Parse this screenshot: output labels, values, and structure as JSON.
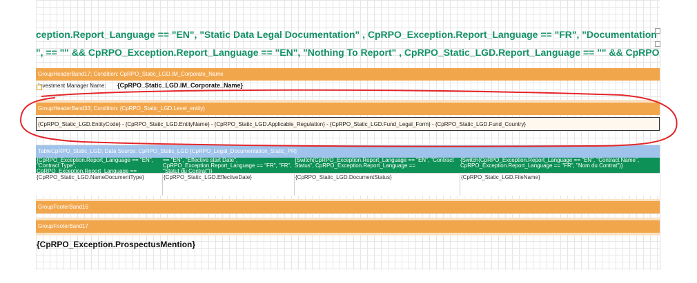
{
  "title_lines": [
    "ception.Report_Language == \"EN\", \"Static Data Legal Documentation\" , CpRPO_Exception.Report_Language == \"FR\", \"Documentation Contractuelle",
    "\", == \"\" && CpRPO_Exception.Report_Language == \"EN\", \"Nothing To Report\" , CpRPO_Static_LGD.Report_Language == \"\" && CpRPO_Exception.Re"
  ],
  "bands": {
    "group_header_17": "GroupHeaderBand17; Condition: CpRPO_Static_LGD.IM_Corporate_Name",
    "group_header_33": "GroupHeaderBand33; Condition: {CpRPO_Static_LGD.Level_entity}",
    "table_band": "TableCpRPO_Static_LGD; Data Source: CpRPO_Static_LGD [CpRPO_Legal_Documentation_Static_PR]",
    "group_footer_16": "GroupFooterBand16",
    "group_footer_17": "GroupFooterBand17"
  },
  "im_row": {
    "label": "Investment Manager Name:",
    "field": "{CpRPO_Static_LGD.IM_Corporate_Name}"
  },
  "entity_row": {
    "text": "{CpRPO_Static_LGD.EntityCode} - {CpRPO_Static_LGD.EntityName} - {CpRPO_Static_LGD.Applicable_Regulation} - {CpRPO_Static_LGD.Fund_Legal_Form} - {CpRPO_Static_LGD.Fund_Country}"
  },
  "table": {
    "headers": [
      "{CpRPO_Exception.Report_Language == \"EN\", \"Contract Type\", CpRPO_Exception.Report_Language ==",
      "== \"EN\", \"Effective start Date\", CpRPO_Exception.Report_Language == \"FR\", \"FR\", \"Statut du Contrat\")}",
      "{Switch(CpRPO_Exception.Report_Language == \"EN\", \"Contract Status\", CpRPO_Exception.Report_Language ==",
      "{Switch(CpRPO_Exception.Report_Language == \"EN\", \"Contract Name\", CpRPO_Exception.Report_Language == \"FR\", \"Nom du Contrat\")}"
    ],
    "cells": [
      "{CpRPO_Static_LGD.NameDocumentType}",
      "{CpRPO_Static_LGD.EffectiveDate}",
      "{CpRPO_Static_LGD.DocumentStatus}",
      "{CpRPO_Static_LGD.FileName}"
    ]
  },
  "prospectus_field": "{CpRPO_Exception.ProspectusMention}",
  "colors": {
    "title_green": "#149168",
    "band_orange": "#f2a64c",
    "band_blue": "#9fc3ea",
    "table_header_green": "#0e9156",
    "annotation_red": "#e3262b"
  }
}
